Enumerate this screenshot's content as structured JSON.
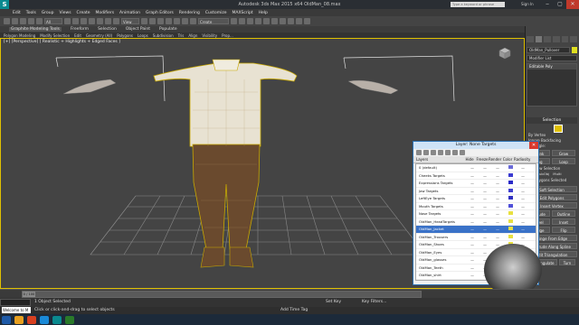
{
  "window": {
    "app_title": "Autodesk 3ds Max 2015 x64    OldMan_08.max",
    "search_placeholder": "Type a keyword or phrase",
    "sign_in": "Sign In"
  },
  "menu": [
    "Edit",
    "Tools",
    "Group",
    "Views",
    "Create",
    "Modifiers",
    "Animation",
    "Graph Editors",
    "Rendering",
    "Customize",
    "MAXScript",
    "Help"
  ],
  "toolbar": {
    "selection_filter": "All",
    "view_dropdown": "View",
    "selection_set": "Create Selection Se"
  },
  "ribbon": {
    "tabs": [
      "Graphite Modeling Tools",
      "Freeform",
      "Selection",
      "Object Paint",
      "Populate"
    ],
    "sub_items": [
      "Polygon Modeling",
      "Modify Selection",
      "Edit",
      "Geometry (All)",
      "Polygons",
      "Loops",
      "Subdivision",
      "Tris",
      "Align",
      "Visibility",
      "Prop..."
    ]
  },
  "viewport": {
    "label": "[+] [Perspective] [ Realistic + Highlights + Edged Faces ]"
  },
  "command_panel": {
    "object_name": "OldMan_Pullover",
    "modifier_list": "Modifier List",
    "modifier_item": "Editable Poly",
    "selection_title": "Selection",
    "by_vertex": "By Vertex",
    "ignore_backfacing": "Ignore Backfacing",
    "by_angle": "By Angle:",
    "shrink": "Shrink",
    "grow": "Grow",
    "ring": "Ring",
    "loop": "Loop",
    "preview_selection": "Preview Selection",
    "off": "Off",
    "subobj": "SubObj",
    "multi": "Multi",
    "polygons_selected": "0 Polygons Selected",
    "soft_selection": "Soft Selection",
    "edit_polygons": "Edit Polygons",
    "insert_vertex": "Insert Vertex",
    "extrude": "Extrude",
    "outline": "Outline",
    "bevel": "Bevel",
    "inset": "Inset",
    "bridge": "Bridge",
    "flip": "Flip",
    "hinge_from_edge": "Hinge From Edge",
    "extrude_along_spline": "Extrude Along Spline",
    "edit_triangulation": "Edit Triangulation",
    "retriangulate": "Retriangulate",
    "turn": "Turn"
  },
  "layer_dialog": {
    "title": "Layer: None Targets",
    "columns": [
      "Layers",
      "Hide",
      "Freeze",
      "Render",
      "Color",
      "Radiosity"
    ],
    "rows": [
      {
        "name": "0 (default)",
        "color": "#6a6ad8",
        "selected": false
      },
      {
        "name": "Cheeks Targets",
        "color": "#3a3ad0",
        "selected": false
      },
      {
        "name": "Expressions Targets",
        "color": "#2a2ac8",
        "selected": false
      },
      {
        "name": "Jaw Targets",
        "color": "#4040d0",
        "selected": false
      },
      {
        "name": "LeftEye Targets",
        "color": "#3030c0",
        "selected": false
      },
      {
        "name": "Mouth Targets",
        "color": "#5050d8",
        "selected": false
      },
      {
        "name": "Nose Targets",
        "color": "#e8e040",
        "selected": false
      },
      {
        "name": "OldMan_HeadTargets",
        "color": "#e8e040",
        "selected": false
      },
      {
        "name": "OldMan_Jacket",
        "color": "#e8e040",
        "selected": true
      },
      {
        "name": "OldMan_Trousers",
        "color": "#e8e040",
        "selected": false
      },
      {
        "name": "OldMan_Shoes",
        "color": "#e8e040",
        "selected": false
      },
      {
        "name": "OldMan_Eyes",
        "color": "#e8e040",
        "selected": false
      },
      {
        "name": "OldMan_glasses",
        "color": "#e8e040",
        "selected": false
      },
      {
        "name": "OldMan_Teeth",
        "color": "#e8e040",
        "selected": false
      },
      {
        "name": "OldMan_shirt",
        "color": "#e8e040",
        "selected": false
      },
      {
        "name": "OldMan_Hair",
        "color": "#e8e040",
        "selected": false
      },
      {
        "name": "OldMan_shoes",
        "color": "#e8e040",
        "selected": false
      }
    ]
  },
  "timeline": {
    "frame_display": "0 / 100"
  },
  "status": {
    "objects_selected": "1 Object Selected",
    "prompt": "Click or click-and-drag to select objects",
    "maxscript": "Welcome to M",
    "add_time_tag": "Add Time Tag",
    "set_key": "Set Key",
    "key_filters": "Key Filters..."
  },
  "colors": {
    "selection_outline": "#e0c000",
    "mesh_shirt": "#e8e2d2",
    "mesh_pants": "#6a4a2e",
    "grid": "#9a9a9a"
  }
}
